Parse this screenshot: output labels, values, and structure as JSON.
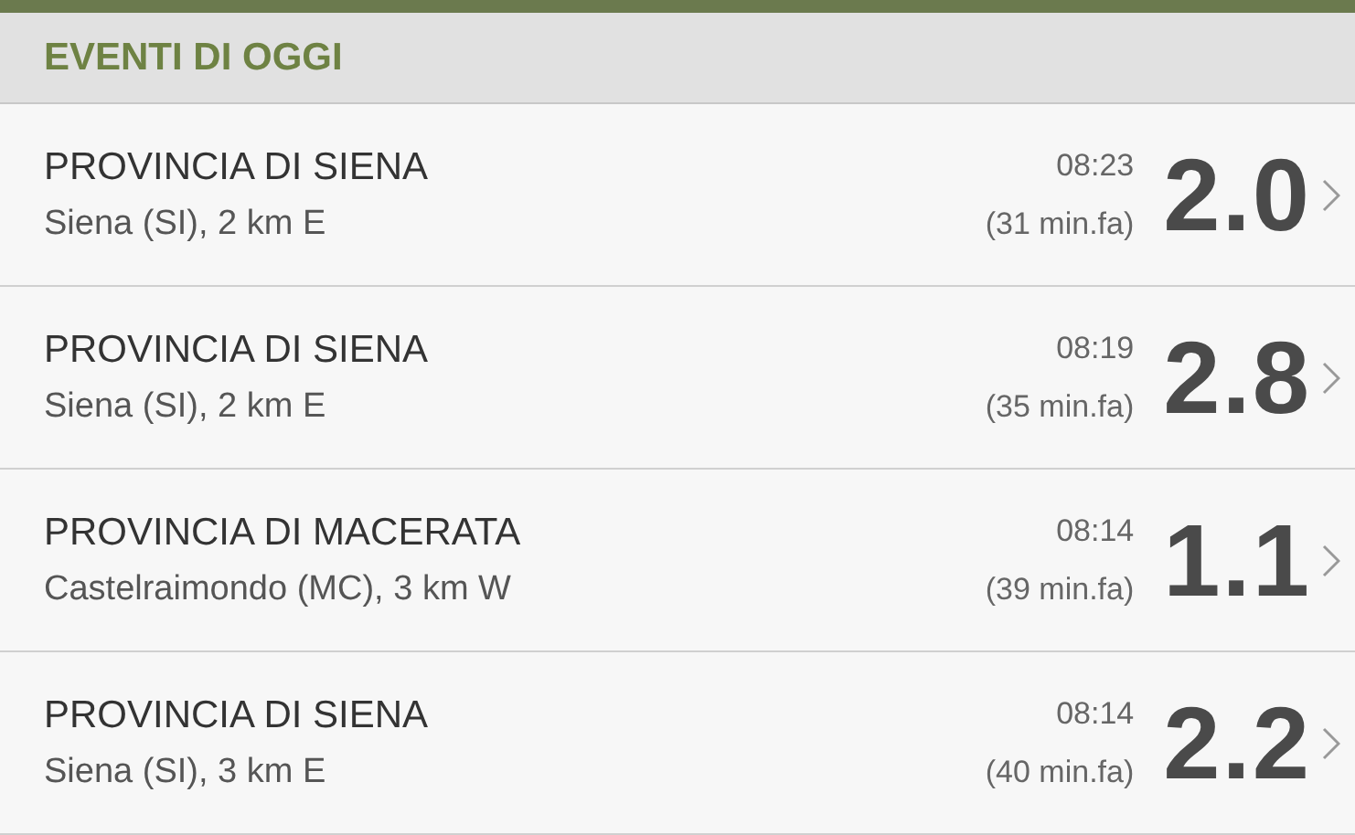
{
  "section": {
    "title": "EVENTI DI OGGI"
  },
  "events": [
    {
      "title": "PROVINCIA DI SIENA",
      "place": "Siena (SI), 2 km E",
      "time": "08:23",
      "ago": "(31 min.fa)",
      "magnitude": "2.0"
    },
    {
      "title": "PROVINCIA DI SIENA",
      "place": "Siena (SI), 2 km E",
      "time": "08:19",
      "ago": "(35 min.fa)",
      "magnitude": "2.8"
    },
    {
      "title": "PROVINCIA DI MACERATA",
      "place": "Castelraimondo (MC), 3 km W",
      "time": "08:14",
      "ago": "(39 min.fa)",
      "magnitude": "1.1"
    },
    {
      "title": "PROVINCIA DI SIENA",
      "place": "Siena (SI), 3 km E",
      "time": "08:14",
      "ago": "(40 min.fa)",
      "magnitude": "2.2"
    }
  ]
}
